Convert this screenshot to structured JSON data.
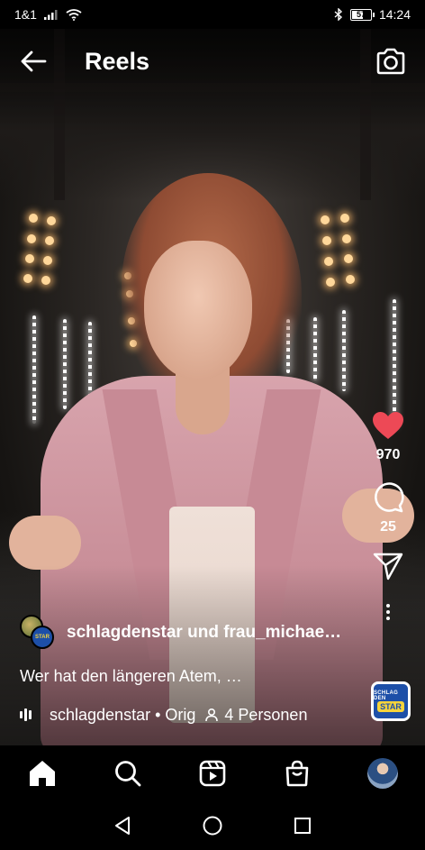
{
  "status_bar": {
    "carrier": "1&1",
    "battery": "57",
    "time": "14:24"
  },
  "header": {
    "title": "Reels",
    "back_icon": "arrow-left-icon",
    "camera_icon": "camera-icon"
  },
  "actions": {
    "likes": "970",
    "comments": "25",
    "like_color": "#ed4956"
  },
  "post": {
    "authors": "schlagdenstar und frau_michae…",
    "caption": "Wer hat den längeren Atem, …",
    "audio": "schlagdenstar • Orig",
    "people": "4 Personen",
    "audio_thumb_top": "SCHLAG DEN",
    "audio_thumb_bottom": "STAR"
  },
  "bottom_nav": {
    "items": [
      "home-icon",
      "search-icon",
      "reels-icon",
      "shop-icon",
      "profile-avatar"
    ]
  },
  "system_nav": {
    "items": [
      "back-triangle-icon",
      "home-circle-icon",
      "recents-square-icon"
    ]
  }
}
